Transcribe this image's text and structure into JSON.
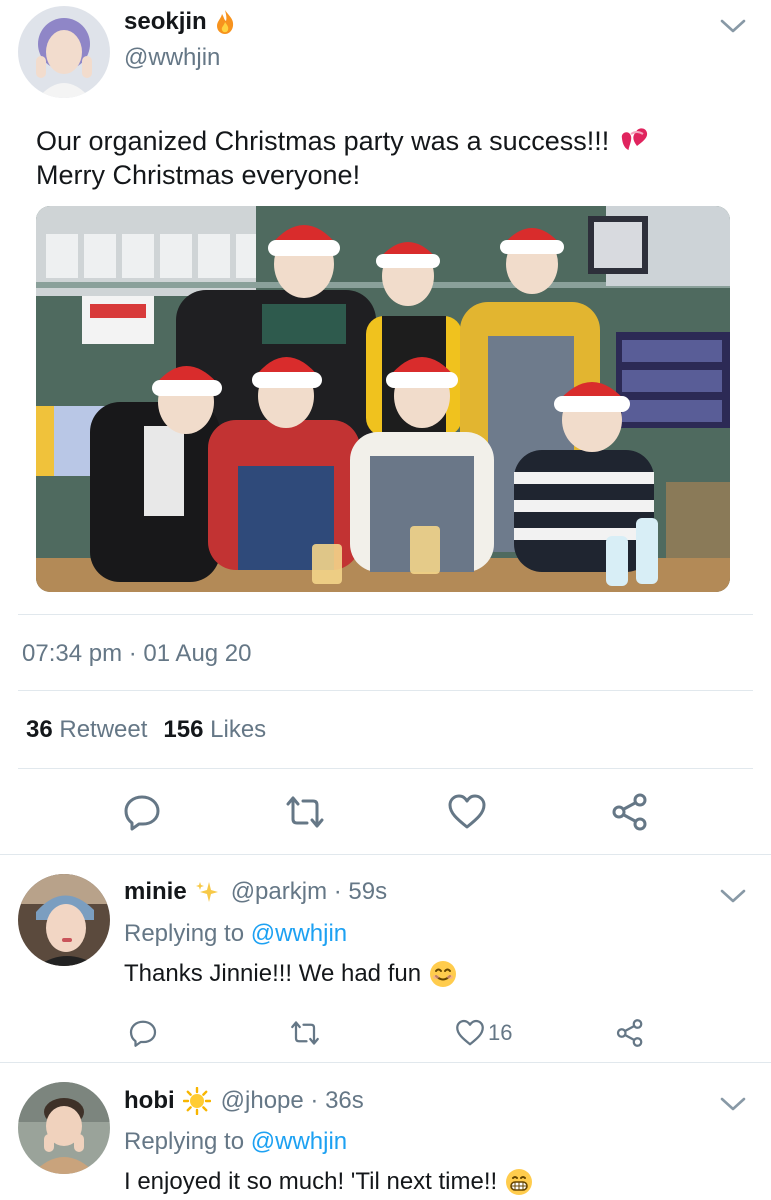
{
  "main_tweet": {
    "display_name": "seokjin",
    "name_emoji": "fire-emoji",
    "handle": "@wwhjin",
    "text_line1": "Our organized Christmas party was a success!!!",
    "text_line1_emoji": "heart-emoji",
    "text_line2": "Merry Christmas everyone!",
    "photo": "group-photo",
    "timestamp": "07:34 pm · 01 Aug 20",
    "retweet_count": "36",
    "retweet_label": "Retweet",
    "like_count": "156",
    "like_label": "Likes",
    "actions": [
      "reply-icon",
      "retweet-icon",
      "like-icon",
      "share-icon"
    ]
  },
  "replies": [
    {
      "display_name": "minie",
      "name_emoji": "sparkles-emoji",
      "handle": "@parkjm · 59s",
      "replying_prefix": "Replying to",
      "replying_to": "@wwhjin",
      "text": "Thanks Jinnie!!! We had fun",
      "text_emoji": "smiling-face-emoji",
      "like_count": "16"
    },
    {
      "display_name": "hobi",
      "name_emoji": "sun-emoji",
      "handle": "@jhope · 36s",
      "replying_prefix": "Replying to",
      "replying_to": "@wwhjin",
      "text": "I enjoyed it so much! 'Til next time!!",
      "text_emoji": "grinning-face-emoji"
    }
  ],
  "colors": {
    "text": "#14171a",
    "secondary": "#657786",
    "link": "#1da1f2",
    "divider": "#e1e8ed"
  }
}
